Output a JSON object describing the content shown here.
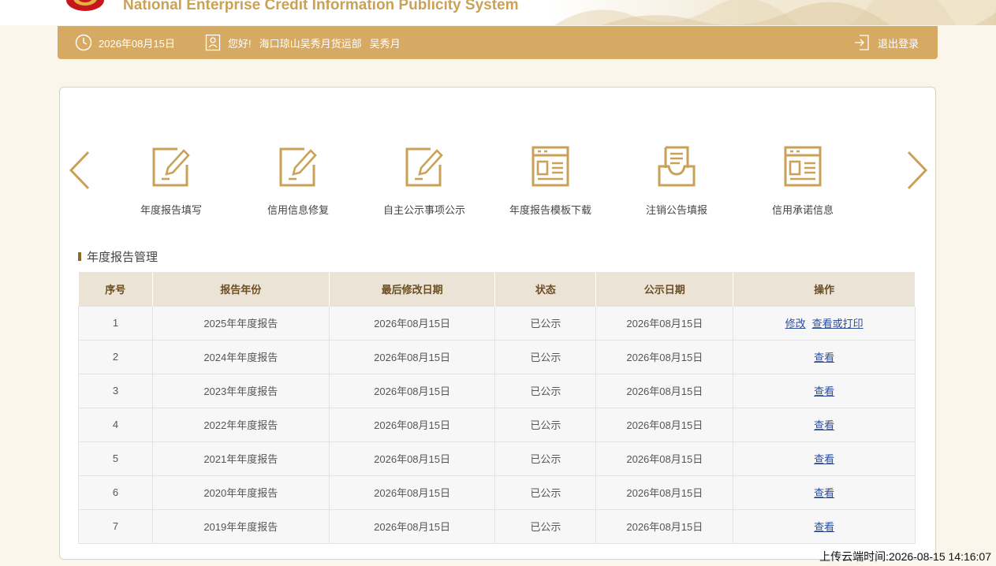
{
  "banner": {
    "title": "National Enterprise Credit Information Publicity System",
    "emblem_icon": "national-emblem-icon",
    "accent_color": "#c9a257"
  },
  "topbar": {
    "date": "2026年08月15日",
    "greeting": "您好!",
    "company": "海口琼山吴秀月货运部",
    "person": "吴秀月",
    "logout_label": "退出登录",
    "bar_color": "#d6aa62"
  },
  "quick_actions": [
    {
      "label": "年度报告填写",
      "icon": "edit-form-icon"
    },
    {
      "label": "信用信息修复",
      "icon": "edit-form-icon"
    },
    {
      "label": "自主公示事项公示",
      "icon": "edit-form-icon"
    },
    {
      "label": "年度报告模板下载",
      "icon": "template-document-icon"
    },
    {
      "label": "注销公告填报",
      "icon": "inbox-document-icon"
    },
    {
      "label": "信用承诺信息",
      "icon": "template-document-icon"
    }
  ],
  "section": {
    "title": "年度报告管理"
  },
  "table": {
    "headers": [
      "序号",
      "报告年份",
      "最后修改日期",
      "状态",
      "公示日期",
      "操作"
    ],
    "rows": [
      {
        "no": "1",
        "year": "2025年年度报告",
        "modified": "2026年08月15日",
        "status": "已公示",
        "published": "2026年08月15日",
        "actions": [
          "修改",
          "查看或打印"
        ]
      },
      {
        "no": "2",
        "year": "2024年年度报告",
        "modified": "2026年08月15日",
        "status": "已公示",
        "published": "2026年08月15日",
        "actions": [
          "查看"
        ]
      },
      {
        "no": "3",
        "year": "2023年年度报告",
        "modified": "2026年08月15日",
        "status": "已公示",
        "published": "2026年08月15日",
        "actions": [
          "查看"
        ]
      },
      {
        "no": "4",
        "year": "2022年年度报告",
        "modified": "2026年08月15日",
        "status": "已公示",
        "published": "2026年08月15日",
        "actions": [
          "查看"
        ]
      },
      {
        "no": "5",
        "year": "2021年年度报告",
        "modified": "2026年08月15日",
        "status": "已公示",
        "published": "2026年08月15日",
        "actions": [
          "查看"
        ]
      },
      {
        "no": "6",
        "year": "2020年年度报告",
        "modified": "2026年08月15日",
        "status": "已公示",
        "published": "2026年08月15日",
        "actions": [
          "查看"
        ]
      },
      {
        "no": "7",
        "year": "2019年年度报告",
        "modified": "2026年08月15日",
        "status": "已公示",
        "published": "2026年08月15日",
        "actions": [
          "查看"
        ]
      }
    ]
  },
  "footer": {
    "upload_time": "上传云端时间:2026-08-15 14:16:07"
  }
}
